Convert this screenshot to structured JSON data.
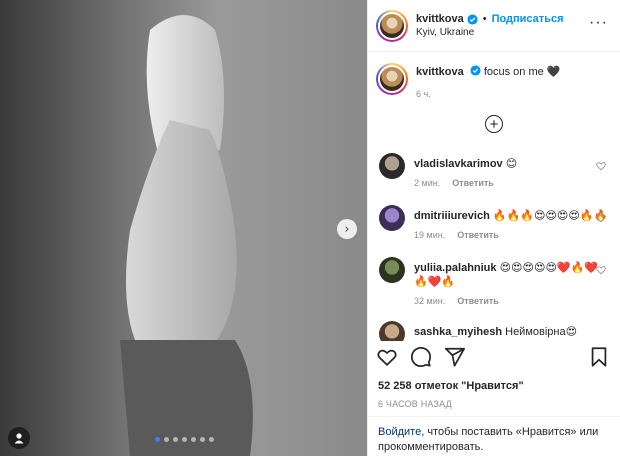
{
  "post": {
    "carousel_dots": 7,
    "active_dot": 0,
    "next_label": "›"
  },
  "header": {
    "username": "kvittkova",
    "bullet": "•",
    "follow_label": "Подписаться",
    "location": "Kyiv, Ukraine",
    "more_label": "···"
  },
  "caption": {
    "username": "kvittkova",
    "text": " focus on me 🖤",
    "time": "6 ч."
  },
  "load_more_label": "+",
  "comments": [
    {
      "username": "vladislavkarimov",
      "text": " 😊",
      "time": "2 мин.",
      "reply": "Ответить"
    },
    {
      "username": "dmitriiiurevich",
      "text": " 🔥🔥🔥😍😍😍😍🔥🔥",
      "time": "19 мин.",
      "reply": "Ответить"
    },
    {
      "username": "yuliia.palahniuk",
      "text": " 😍😍😍😍😍❤️🔥❤️🔥❤️🔥",
      "time": "32 мин.",
      "reply": "Ответить"
    },
    {
      "username": "sashka_myihesh",
      "text": " Неймовірна😍",
      "time": "",
      "reply": ""
    }
  ],
  "likes": "52 258 отметок \"Нравится\"",
  "posted_time": "6 ЧАСОВ НАЗАД",
  "login": {
    "login_link": "Войдите",
    "text": ", чтобы поставить «Нравится» или прокомментировать."
  },
  "colors": {
    "accent": "#0095f6",
    "link_dark": "#00376b",
    "muted": "#8e8e8e"
  }
}
